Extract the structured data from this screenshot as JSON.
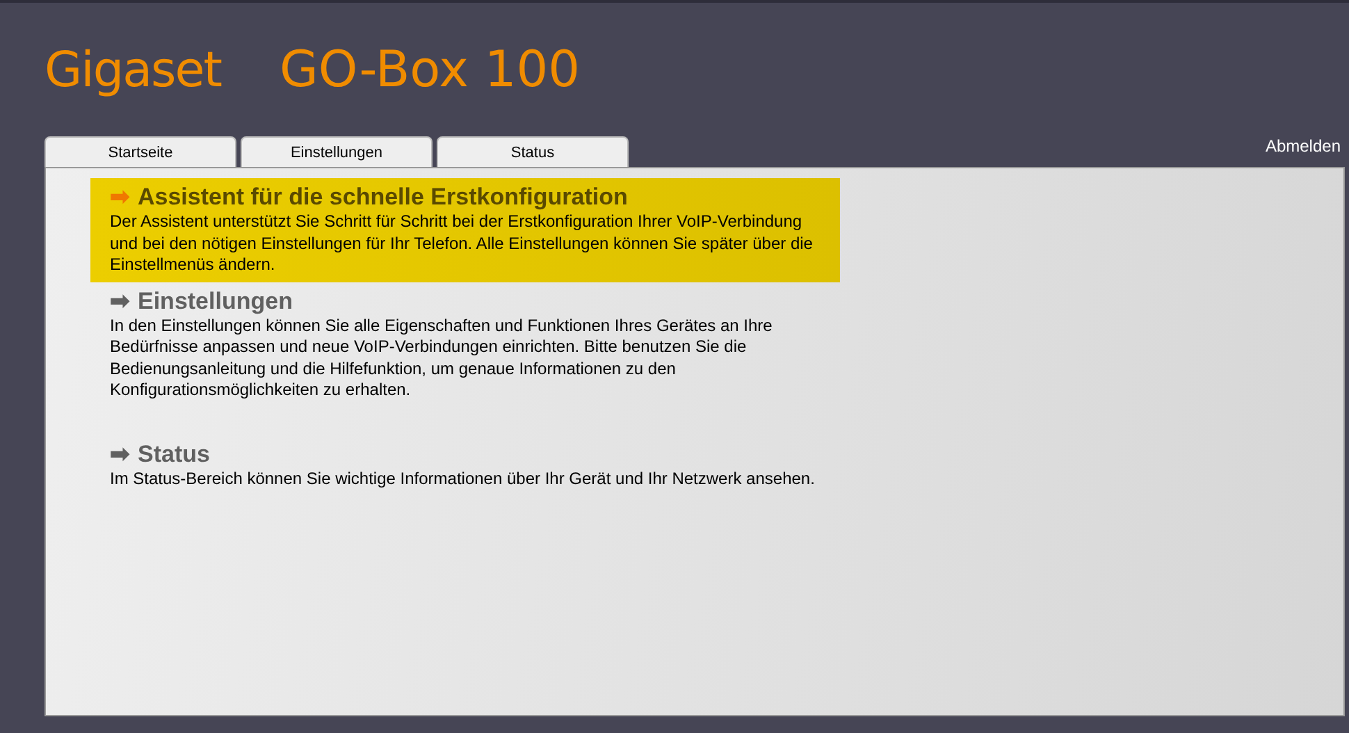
{
  "header": {
    "brand": "Gigaset",
    "product": "GO-Box 100"
  },
  "tabs": [
    {
      "label": "Startseite",
      "selected": false
    },
    {
      "label": "Einstellungen",
      "selected": false
    },
    {
      "label": "Status",
      "selected": false
    }
  ],
  "logout": "Abmelden",
  "sections": [
    {
      "arrow": "➡",
      "title": "Assistent für die schnelle Erstkonfiguration",
      "text": "Der Assistent unterstützt Sie Schritt für Schritt bei der Erstkonfiguration Ihrer VoIP-Verbindung und bei den nötigen Einstellungen für Ihr Telefon. Alle Einstellungen können Sie später über die Einstellmenüs ändern.",
      "highlighted": true
    },
    {
      "arrow": "➡",
      "title": "Einstellungen",
      "text": "In den Einstellungen können Sie alle Eigenschaften und Funktionen Ihres Gerätes an Ihre Bedürfnisse anpassen und neue VoIP-Verbindungen einrichten. Bitte benutzen Sie die Bedienungsanleitung und die Hilfefunktion, um genaue Informationen zu den Konfigurationsmöglichkeiten zu erhalten.",
      "highlighted": false
    },
    {
      "arrow": "➡",
      "title": "Status",
      "text": "Im Status-Bereich können Sie wichtige Informationen über Ihr Gerät und Ihr Netzwerk ansehen.",
      "highlighted": false
    }
  ]
}
